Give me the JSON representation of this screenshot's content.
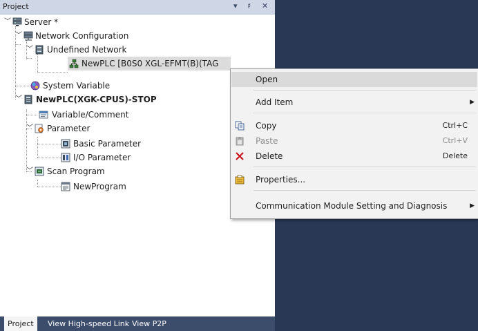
{
  "panel": {
    "title": "Project",
    "controls": {
      "dropdown": "▾",
      "pin": "♯",
      "close": "✕"
    }
  },
  "tree": {
    "server": "Server *",
    "network_config": "Network Configuration",
    "undefined_network": "Undefined Network",
    "newplc_network": "NewPLC [B0S0 XGL-EFMT(B)(TAG",
    "system_variable": "System Variable",
    "plc": "NewPLC(XGK-CPUS)-STOP",
    "variable_comment": "Variable/Comment",
    "parameter": "Parameter",
    "basic_parameter": "Basic Parameter",
    "io_parameter": "I/O Parameter",
    "scan_program": "Scan Program",
    "new_program": "NewProgram"
  },
  "tabs": [
    "Project",
    "View High-speed Link",
    "View P2P"
  ],
  "context_menu": {
    "open": "Open",
    "add_item": "Add Item",
    "copy": "Copy",
    "copy_shortcut": "Ctrl+C",
    "paste": "Paste",
    "paste_shortcut": "Ctrl+V",
    "delete": "Delete",
    "delete_shortcut": "Delete",
    "properties": "Properties...",
    "comm_module": "Communication Module Setting and Diagnosis"
  },
  "colors": {
    "background": "#293955",
    "titlebar": "#cfd6e5",
    "tabbar": "#3c4c6b",
    "menu_bg": "#f2f2f2",
    "highlight": "#dadada"
  }
}
